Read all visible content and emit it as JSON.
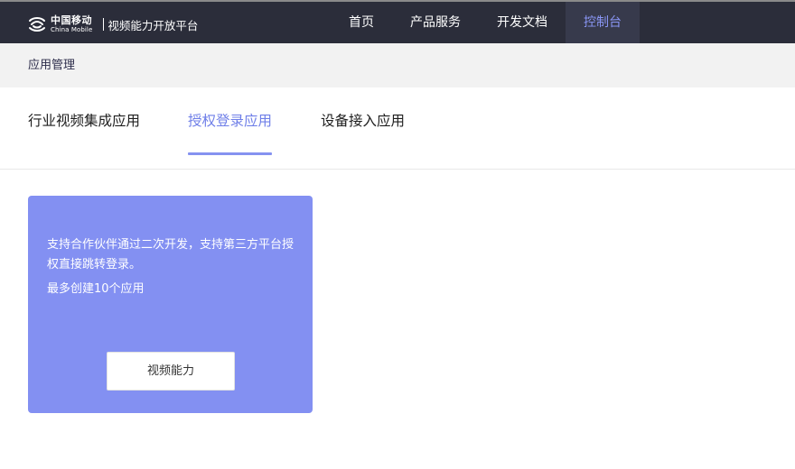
{
  "header": {
    "logo": {
      "icon": "china-mobile-logo-icon",
      "name_cn": "中国移动",
      "name_en": "China Mobile"
    },
    "platform_name": "视频能力开放平台",
    "nav": [
      {
        "label": "首页",
        "active": false
      },
      {
        "label": "产品服务",
        "active": false
      },
      {
        "label": "开发文档",
        "active": false
      },
      {
        "label": "控制台",
        "active": true
      }
    ]
  },
  "subheader": {
    "title": "应用管理"
  },
  "tabs": [
    {
      "label": "行业视频集成应用",
      "active": false
    },
    {
      "label": "授权登录应用",
      "active": true
    },
    {
      "label": "设备接入应用",
      "active": false
    }
  ],
  "card": {
    "description": "支持合作伙伴通过二次开发，支持第三方平台授权直接跳转登录。",
    "limit": "最多创建10个应用",
    "button_label": "视频能力"
  },
  "colors": {
    "topbar": "#2b2d3a",
    "accent": "#8390f2",
    "active_nav_text": "#8a96f5",
    "active_tab_text": "#6f7fe8"
  }
}
